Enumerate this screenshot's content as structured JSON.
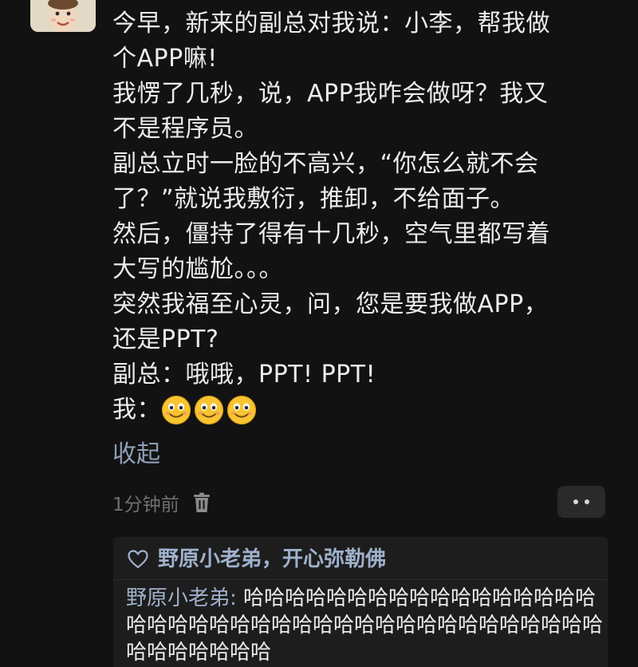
{
  "post": {
    "lines": [
      "今早，新来的副总对我说：小李，帮我做",
      "个APP嘛!",
      "我愣了几秒，说，APP我咋会做呀？我又",
      "不是程序员。",
      "副总立时一脸的不高兴，“你怎么就不会",
      "了？”就说我敷衍，推卸，不给面子。",
      "然后，僵持了得有十几秒，空气里都写着",
      "大写的尴尬。。。",
      "突然我福至心灵，问，您是要我做APP，",
      "还是PPT?",
      "副总：哦哦，PPT! PPT!"
    ],
    "last_line_prefix": "我：",
    "emojis": [
      "smiling-face-icon",
      "smiling-face-icon",
      "smiling-face-icon"
    ]
  },
  "collapse_label": "收起",
  "timestamp": "1分钟前",
  "reply": {
    "likes_text": "野原小老弟，开心弥勒佛",
    "author": "野原小老弟",
    "separator": ":",
    "text": "哈哈哈哈哈哈哈哈哈哈哈哈哈哈哈哈哈哈哈哈哈哈哈哈哈哈哈哈哈哈哈哈哈哈哈哈哈哈哈哈哈哈哈哈哈哈哈"
  },
  "colors": {
    "background": "#121212",
    "text": "#ececec",
    "link": "#8f9fb6",
    "reply_name": "#9fb1cc",
    "reply_bg": "#1d1d1d",
    "emoji_face": "#f7c531"
  }
}
